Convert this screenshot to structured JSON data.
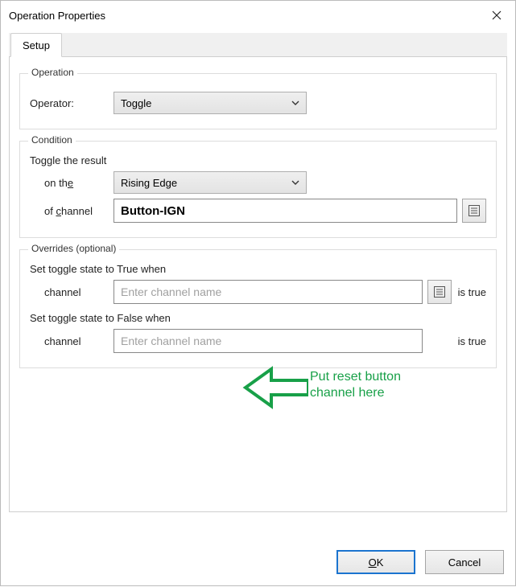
{
  "window": {
    "title": "Operation Properties"
  },
  "tabs": {
    "setup": "Setup"
  },
  "operation": {
    "legend": "Operation",
    "operator_label": "Operator:",
    "operator_value": "Toggle"
  },
  "condition": {
    "legend": "Condition",
    "header": "Toggle the result",
    "on_the_label_pre": "on th",
    "on_the_label_ul": "e",
    "edge_value": "Rising Edge",
    "of_channel_label_pre": "of ",
    "of_channel_label_ul": "c",
    "of_channel_label_post": "hannel",
    "channel_value": "Button-IGN"
  },
  "overrides": {
    "legend": "Overrides (optional)",
    "true_header": "Set toggle state to True when",
    "false_header": "Set toggle state to False when",
    "channel_label": "channel",
    "placeholder": "Enter channel name",
    "suffix": "is true"
  },
  "buttons": {
    "ok_ul": "O",
    "ok_rest": "K",
    "cancel": "Cancel"
  },
  "annotation": {
    "line1": "Put reset button",
    "line2": "channel here"
  }
}
